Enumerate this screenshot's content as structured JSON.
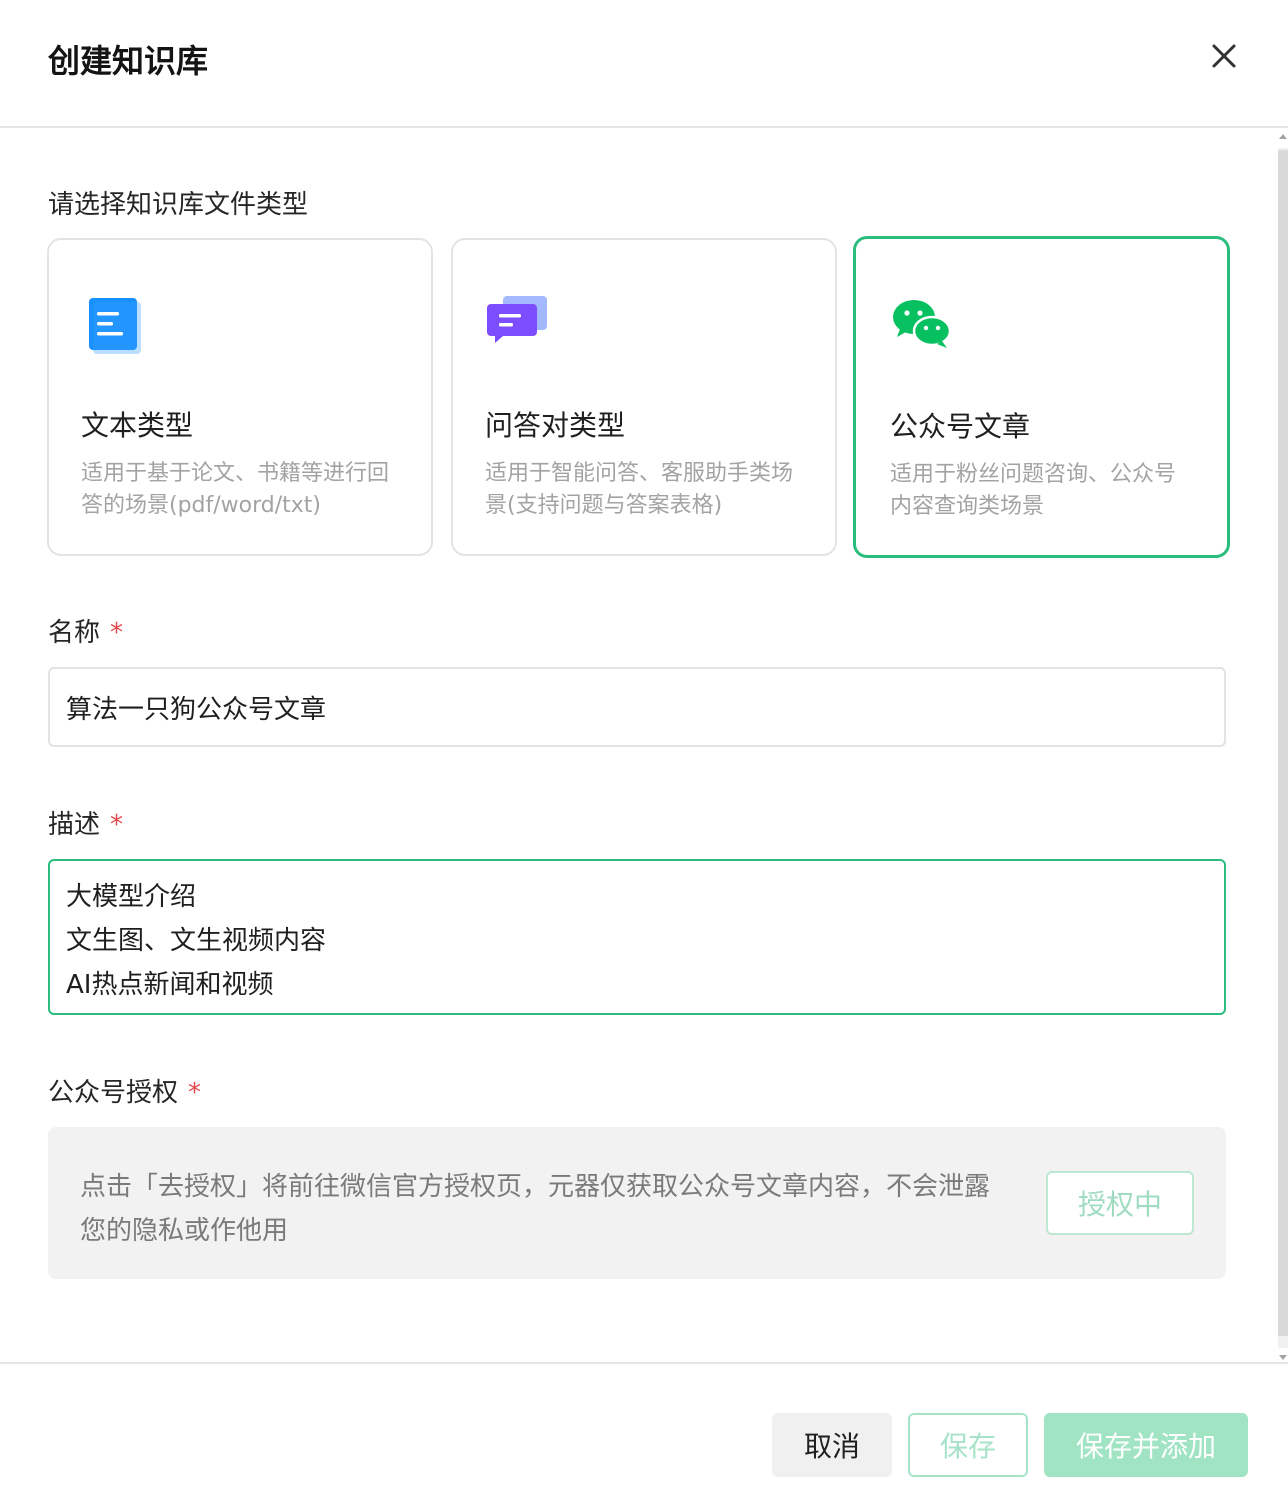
{
  "dialog": {
    "title": "创建知识库"
  },
  "file_type": {
    "label": "请选择知识库文件类型",
    "options": [
      {
        "name": "文本类型",
        "desc": "适用于基于论文、书籍等进行回答的场景(pdf/word/txt)",
        "icon": "document-icon",
        "selected": false
      },
      {
        "name": "问答对类型",
        "desc": "适用于智能问答、客服助手类场景(支持问题与答案表格)",
        "icon": "chat-bubbles-icon",
        "selected": false
      },
      {
        "name": "公众号文章",
        "desc": "适用于粉丝问题咨询、公众号内容查询类场景",
        "icon": "wechat-icon",
        "selected": true
      }
    ]
  },
  "name_field": {
    "label": "名称",
    "required_mark": "*",
    "value": "算法一只狗公众号文章"
  },
  "desc_field": {
    "label": "描述",
    "required_mark": "*",
    "lines": [
      "大模型介绍",
      "文生图、文生视频内容",
      "AI热点新闻和视频"
    ]
  },
  "auth_field": {
    "label": "公众号授权",
    "required_mark": "*",
    "notice": "点击「去授权」将前往微信官方授权页，元器仅获取公众号文章内容，不会泄露您的隐私或作他用",
    "button_label": "授权中"
  },
  "footer": {
    "cancel_label": "取消",
    "save_label": "保存",
    "save_add_label": "保存并添加"
  },
  "colors": {
    "accent": "#2bbd7e",
    "required": "#e5484d",
    "doc_icon": "#1890ff",
    "chat_icon": "#7c4dff",
    "wechat_icon": "#07c160"
  }
}
